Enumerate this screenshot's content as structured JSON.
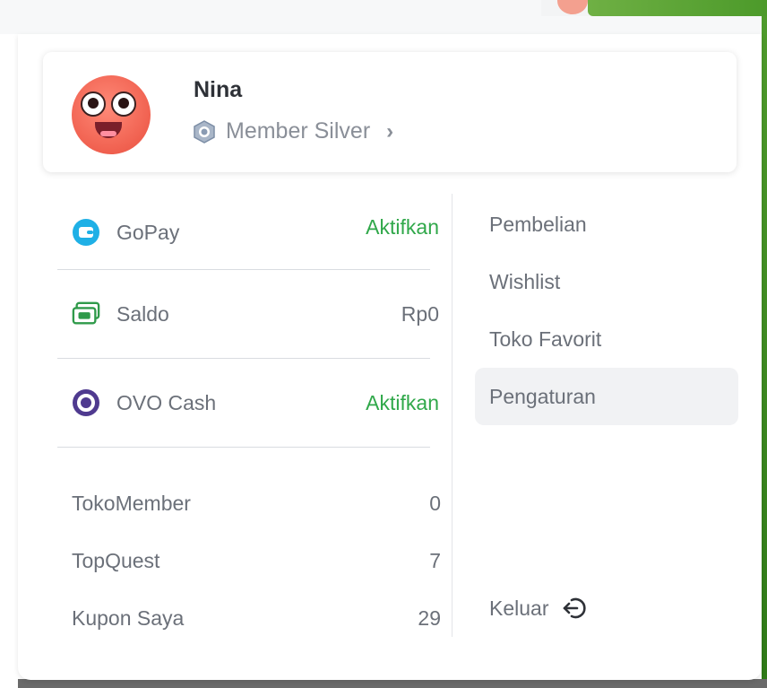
{
  "profile": {
    "name": "Nina",
    "membership": "Member Silver"
  },
  "wallets": [
    {
      "icon": "gopay-icon",
      "label": "GoPay",
      "value": "Aktifkan",
      "value_color": "#30a84a"
    },
    {
      "icon": "saldo-icon",
      "label": "Saldo",
      "value": "Rp0",
      "value_color": "#6b7079"
    },
    {
      "icon": "ovo-icon",
      "label": "OVO Cash",
      "value": "Aktifkan",
      "value_color": "#30a84a"
    }
  ],
  "stats": [
    {
      "label": "TokoMember",
      "value": "0"
    },
    {
      "label": "TopQuest",
      "value": "7"
    },
    {
      "label": "Kupon Saya",
      "value": "29"
    }
  ],
  "menu": {
    "items": [
      {
        "label": "Pembelian"
      },
      {
        "label": "Wishlist"
      },
      {
        "label": "Toko Favorit"
      },
      {
        "label": "Pengaturan"
      }
    ],
    "active": "Pengaturan",
    "logout_label": "Keluar"
  },
  "colors": {
    "accent_green": "#30a84a",
    "text_grey": "#6b7079",
    "gopay_blue": "#1fb0e6",
    "saldo_green": "#2f9a4a",
    "ovo_purple": "#4f3a8f"
  }
}
